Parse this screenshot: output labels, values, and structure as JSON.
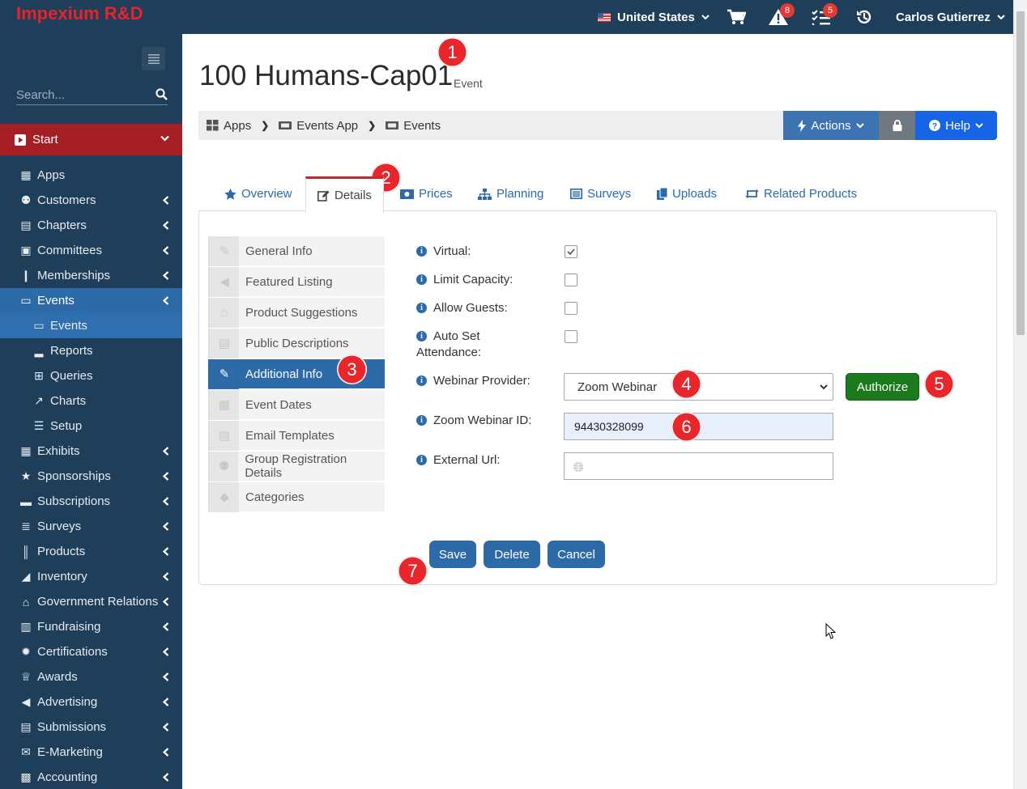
{
  "topbar": {
    "brand": "Impexium R&D",
    "country": "United States",
    "alerts_count": "8",
    "tasks_count": "5",
    "user_name": "Carlos Gutierrez"
  },
  "sidebar": {
    "search_placeholder": "Search...",
    "start_label": "Start",
    "items": [
      {
        "label": "Apps",
        "icon": "grid-icon"
      },
      {
        "label": "Customers",
        "icon": "users-icon"
      },
      {
        "label": "Chapters",
        "icon": "archive-icon"
      },
      {
        "label": "Committees",
        "icon": "briefcase-icon"
      },
      {
        "label": "Memberships",
        "icon": "bookmark-icon"
      },
      {
        "label": "Events",
        "icon": "ticket-icon"
      },
      {
        "label": "Events",
        "icon": "ticket-icon"
      },
      {
        "label": "Reports",
        "icon": "bar-chart-icon"
      },
      {
        "label": "Queries",
        "icon": "table-icon"
      },
      {
        "label": "Charts",
        "icon": "line-chart-icon"
      },
      {
        "label": "Setup",
        "icon": "list-icon"
      },
      {
        "label": "Exhibits",
        "icon": "grid-icon"
      },
      {
        "label": "Sponsorships",
        "icon": "star-icon"
      },
      {
        "label": "Subscriptions",
        "icon": "inbox-icon"
      },
      {
        "label": "Surveys",
        "icon": "list-alt-icon"
      },
      {
        "label": "Products",
        "icon": "barcode-icon"
      },
      {
        "label": "Inventory",
        "icon": "industry-icon"
      },
      {
        "label": "Government Relations",
        "icon": "institution-icon"
      },
      {
        "label": "Fundraising",
        "icon": "money-icon"
      },
      {
        "label": "Certifications",
        "icon": "certificate-icon"
      },
      {
        "label": "Awards",
        "icon": "trophy-icon"
      },
      {
        "label": "Advertising",
        "icon": "bullhorn-icon"
      },
      {
        "label": "Submissions",
        "icon": "file-icon"
      },
      {
        "label": "E-Marketing",
        "icon": "envelope-icon"
      },
      {
        "label": "Accounting",
        "icon": "book-icon"
      }
    ]
  },
  "header": {
    "title": "100 Humans-Cap01",
    "subtitle": "Event"
  },
  "breadcrumb": [
    "Apps",
    "Events App",
    "Events"
  ],
  "toolbar": {
    "actions_label": "Actions",
    "help_label": "Help"
  },
  "tabs": [
    "Overview",
    "Details",
    "Prices",
    "Planning",
    "Surveys",
    "Uploads",
    "Related Products"
  ],
  "subnav": [
    "General Info",
    "Featured Listing",
    "Product Suggestions",
    "Public Descriptions",
    "Additional Info",
    "Event Dates",
    "Email Templates",
    "Group Registration Details",
    "Categories"
  ],
  "form": {
    "virtual_label": "Virtual:",
    "virtual_checked": true,
    "limit_capacity_label": "Limit Capacity:",
    "allow_guests_label": "Allow Guests:",
    "auto_attendance_label_1": "Auto Set",
    "auto_attendance_label_2": "Attendance:",
    "webinar_provider_label": "Webinar Provider:",
    "webinar_provider_value": "Zoom Webinar",
    "authorize_label": "Authorize",
    "zoom_id_label": "Zoom Webinar ID:",
    "zoom_id_value": "94430328099",
    "external_url_label": "External Url:",
    "external_url_value": ""
  },
  "buttons": {
    "save": "Save",
    "delete": "Delete",
    "cancel": "Cancel"
  },
  "callouts": [
    "1",
    "2",
    "3",
    "4",
    "5",
    "6",
    "7"
  ],
  "colors": {
    "nav_bg": "#1e3e5a",
    "brand_red": "#e8232a",
    "start_red": "#a51e23",
    "primary_blue": "#2d6aa8",
    "help_blue": "#1565e6",
    "authorize_green": "#1b7a1b",
    "callout_red": "#e8262b"
  }
}
